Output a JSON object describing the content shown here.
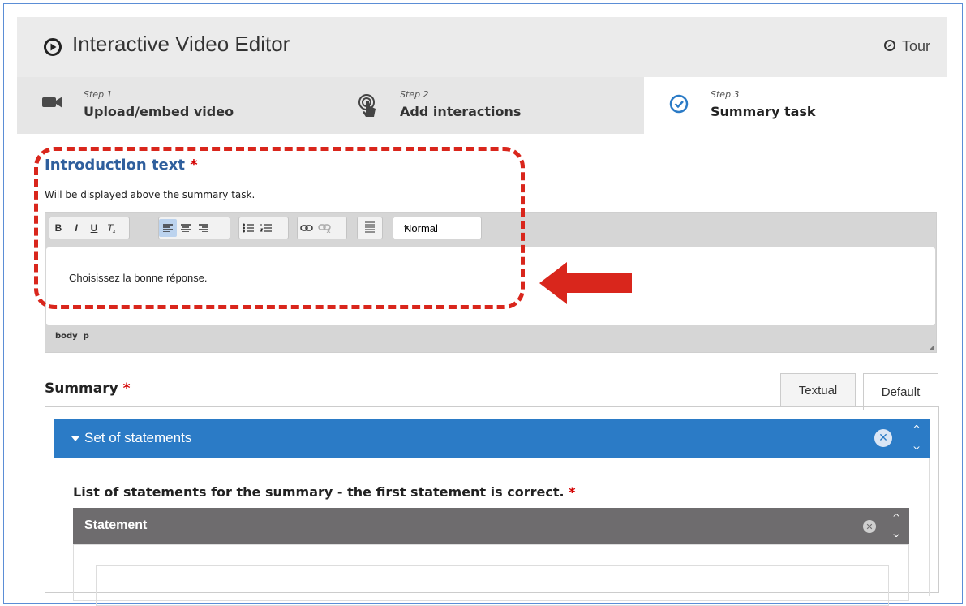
{
  "header": {
    "title": "Interactive Video Editor",
    "tour_label": "Tour"
  },
  "steps": [
    {
      "step": "Step 1",
      "label": "Upload/embed video",
      "icon": "video-camera-icon"
    },
    {
      "step": "Step 2",
      "label": "Add interactions",
      "icon": "touch-icon"
    },
    {
      "step": "Step 3",
      "label": "Summary task",
      "icon": "check-circle-icon",
      "active": true
    }
  ],
  "intro": {
    "label": "Introduction text",
    "required_mark": "*",
    "description": "Will be displayed above the summary task.",
    "format_value": "Normal",
    "content": "Choisissez la bonne réponse.",
    "path": "body  p"
  },
  "toolbar": {
    "bold": "B",
    "italic": "I",
    "underline": "U",
    "clear": "Ix"
  },
  "summary": {
    "label": "Summary",
    "required_mark": "*",
    "tabs": [
      "Textual",
      "Default"
    ],
    "set_title": "Set of statements",
    "list_label": "List of statements for the summary - the first statement is correct.",
    "statement_title": "Statement"
  },
  "colors": {
    "accent_blue": "#2b7bc6",
    "required_red": "#d40000",
    "annotation_red": "#d9261c",
    "statement_gray": "#6e6c6e"
  }
}
